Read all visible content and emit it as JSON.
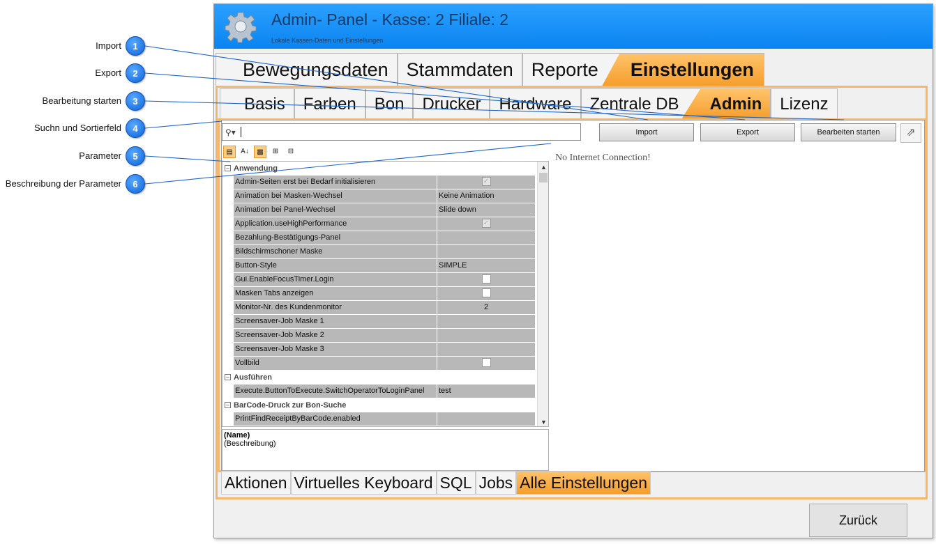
{
  "callouts": [
    {
      "num": "1",
      "label": "Import"
    },
    {
      "num": "2",
      "label": "Export"
    },
    {
      "num": "3",
      "label": "Bearbeitung starten"
    },
    {
      "num": "4",
      "label": "Suchn und Sortierfeld"
    },
    {
      "num": "5",
      "label": "Parameter"
    },
    {
      "num": "6",
      "label": "Beschreibung der Parameter"
    }
  ],
  "window": {
    "title": "Admin- Panel - Kasse: 2 Filiale: 2",
    "subtitle": "Lokale Kassen-Daten und Einstellungen"
  },
  "top_tabs": [
    {
      "label": "Bewegungsdaten",
      "active": false
    },
    {
      "label": "Stammdaten",
      "active": false
    },
    {
      "label": "Reporte",
      "active": false
    },
    {
      "label": "Einstellungen",
      "active": true
    }
  ],
  "sub_tabs": [
    {
      "label": "Basis",
      "active": false
    },
    {
      "label": "Farben",
      "active": false
    },
    {
      "label": "Bon",
      "active": false
    },
    {
      "label": "Drucker",
      "active": false
    },
    {
      "label": "Hardware",
      "active": false
    },
    {
      "label": "Zentrale DB",
      "active": false
    },
    {
      "label": "Admin",
      "active": true
    },
    {
      "label": "Lizenz",
      "active": false
    }
  ],
  "search": {
    "value": "",
    "icon": "search-icon"
  },
  "buttons": {
    "import": "Import",
    "export": "Export",
    "edit": "Bearbeiten starten"
  },
  "property_grid": {
    "groups": [
      {
        "name": "Anwendung",
        "rows": [
          {
            "name": "Admin-Seiten erst bei Bedarf initialisieren",
            "value": "",
            "checkbox": "checked-disabled"
          },
          {
            "name": "Animation bei Masken-Wechsel",
            "value": "Keine Animation"
          },
          {
            "name": "Animation bei Panel-Wechsel",
            "value": "Slide down"
          },
          {
            "name": "Application.useHighPerformance",
            "value": "",
            "checkbox": "checked-disabled"
          },
          {
            "name": "Bezahlung-Bestätigungs-Panel",
            "value": ""
          },
          {
            "name": "Bildschirmschoner Maske",
            "value": ""
          },
          {
            "name": "Button-Style",
            "value": "SIMPLE"
          },
          {
            "name": "Gui.EnableFocusTimer.Login",
            "value": "",
            "checkbox": "unchecked"
          },
          {
            "name": "Masken Tabs anzeigen",
            "value": "",
            "checkbox": "unchecked"
          },
          {
            "name": "Monitor-Nr. des Kundenmonitor",
            "value": "2",
            "center": true
          },
          {
            "name": "Screensaver-Job Maske 1",
            "value": ""
          },
          {
            "name": "Screensaver-Job Maske 2",
            "value": ""
          },
          {
            "name": "Screensaver-Job Maske 3",
            "value": ""
          },
          {
            "name": "Vollbild",
            "value": "",
            "checkbox": "unchecked"
          }
        ]
      },
      {
        "name": "Ausführen",
        "rows": [
          {
            "name": "Execute.ButtonToExecute.SwitchOperatorToLoginPanel",
            "value": "test"
          }
        ]
      },
      {
        "name": "BarCode-Druck zur Bon-Suche",
        "rows": [
          {
            "name": "PrintFindReceiptByBarCode.enabled",
            "value": ""
          }
        ]
      }
    ]
  },
  "description": {
    "name": "(Name)",
    "text": "(Beschreibung)"
  },
  "web_panel": {
    "message": "No Internet Connection!"
  },
  "bottom_tabs": [
    {
      "label": "Aktionen",
      "active": false
    },
    {
      "label": "Virtuelles Keyboard",
      "active": false
    },
    {
      "label": "SQL",
      "active": false
    },
    {
      "label": "Jobs",
      "active": false
    },
    {
      "label": "Alle Einstellungen",
      "active": true
    }
  ],
  "footer": {
    "back_label": "Zurück"
  },
  "colors": {
    "accent": "#f59d2b",
    "titlebar": "#0a84f0",
    "callout": "#0a63d8"
  }
}
